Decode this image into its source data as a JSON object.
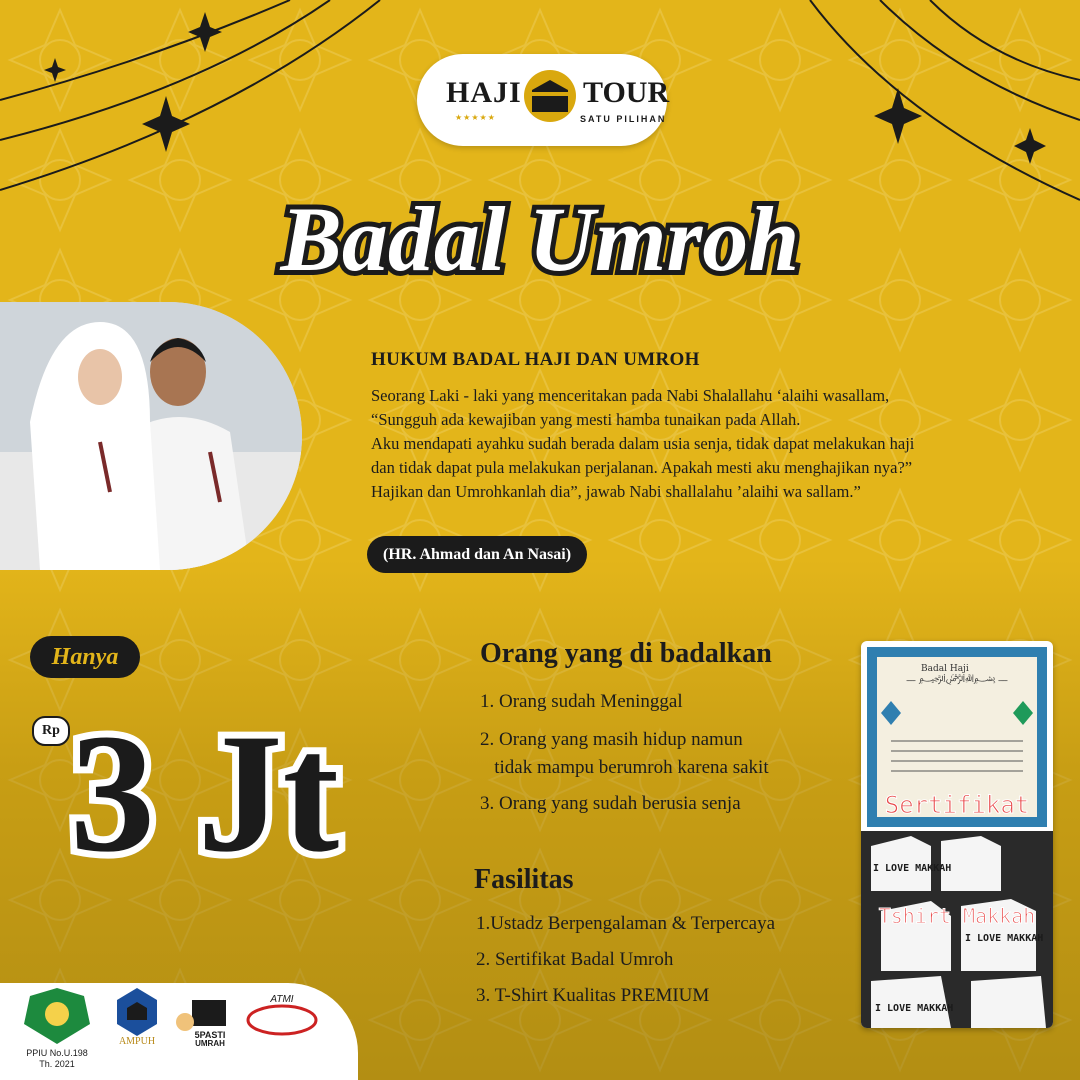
{
  "brand": {
    "left": "HAJI",
    "right": "TOUR",
    "stars": "★★★★★",
    "sub": "SATU PILIHAN"
  },
  "title": "Badal Umroh",
  "hadith": {
    "title": "HUKUM BADAL HAJI DAN UMROH",
    "text": "Seorang Laki - laki yang menceritakan pada Nabi Shalallahu ‘alaihi wasallam,\n“Sungguh ada kewajiban yang mesti hamba tunaikan pada Allah.\nAku mendapati ayahku sudah berada dalam usia senja, tidak dapat melakukan haji\ndan tidak  dapat pula melakukan perjalanan.  Apakah mesti aku menghajikan nya?”\nHajikan dan Umrohkanlah dia”,  jawab Nabi shallalahu ’alaihi wa sallam.”",
    "source": "(HR. Ahmad  dan An Nasai)"
  },
  "price": {
    "prefix": "Hanya",
    "currency": "Rp",
    "amount": "3 Jt"
  },
  "badal": {
    "title": "Orang yang di badalkan",
    "items": [
      "1. Orang sudah Meninggal",
      "2. Orang yang masih hidup namun\n   tidak mampu berumroh karena sakit",
      "3. Orang yang sudah berusia senja"
    ]
  },
  "fasilitas": {
    "title": "Fasilitas",
    "items": [
      "1.Ustadz Berpengalaman & Terpercaya",
      "2. Sertifikat Badal Umroh",
      "3. T-Shirt Kualitas PREMIUM"
    ]
  },
  "certificate": {
    "label1": "Sertifikat",
    "label2": "Tshirt Makkah",
    "shirt_text": "I LOVE MAKKAH",
    "header": "Badal Haji"
  },
  "footer": {
    "ppiu": "PPIU No.U.198\nTh. 2021",
    "ampuh": "AMPUH",
    "pasti": "5PASTI\nUMRAH",
    "atmi": "ATMI"
  },
  "colors": {
    "gold": "#E3B51A",
    "dark": "#1b1b1b",
    "title_stroke": "#1b1b1b",
    "title_fill": "#FFFFFF"
  }
}
